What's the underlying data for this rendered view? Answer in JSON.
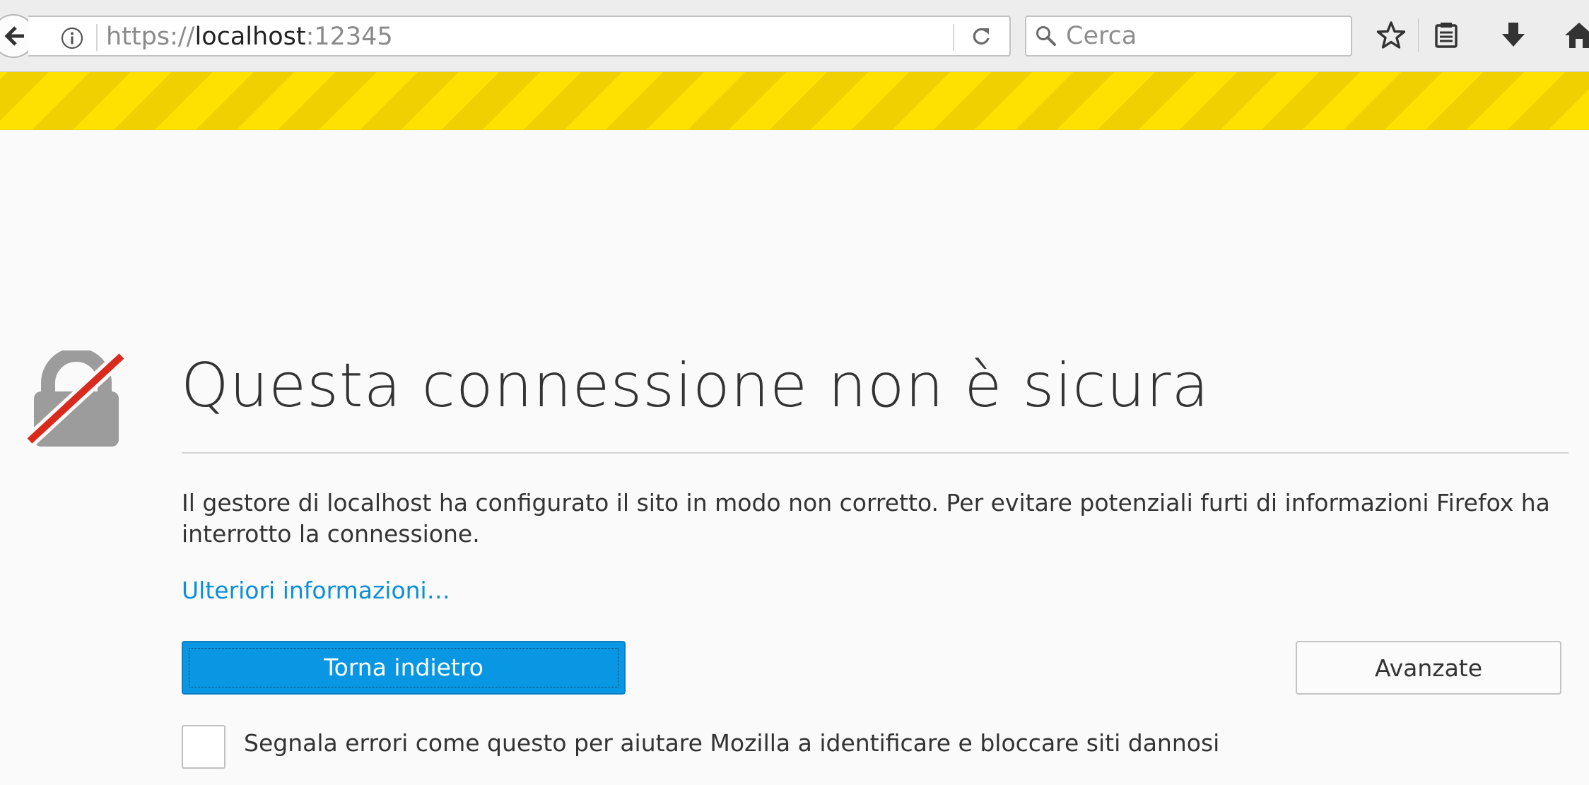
{
  "browser": {
    "url": {
      "scheme": "https://",
      "host": "localhost",
      "port": ":12345"
    },
    "search": {
      "placeholder": "Cerca",
      "value": ""
    },
    "icons": {
      "back": "arrow-left-icon",
      "site_info": "info-icon",
      "reload": "reload-icon",
      "search": "search-icon",
      "bookmark": "star-icon",
      "reading_list": "library-icon",
      "downloads": "download-icon",
      "home": "home-icon"
    },
    "warning_stripe_colors": [
      "#ffe100",
      "#f0d000"
    ]
  },
  "error_page": {
    "icon": "broken-lock-icon",
    "title": "Questa connessione non è sicura",
    "description": "Il gestore di localhost ha configurato il sito in modo non corretto. Per evitare potenziali furti di informazioni Firefox ha interrotto la connessione.",
    "learn_more": "Ulteriori informazioni…",
    "back_button": "Torna indietro",
    "advanced_button": "Avanzate",
    "report_checkbox": {
      "checked": false,
      "label": "Segnala errori come questo per aiutare Mozilla a identificare e bloccare siti dannosi"
    },
    "colors": {
      "primary_button": "#0996e3",
      "link": "#0a8fdc",
      "lock_gray": "#9c9c9c",
      "lock_slash": "#d92b1d"
    }
  }
}
